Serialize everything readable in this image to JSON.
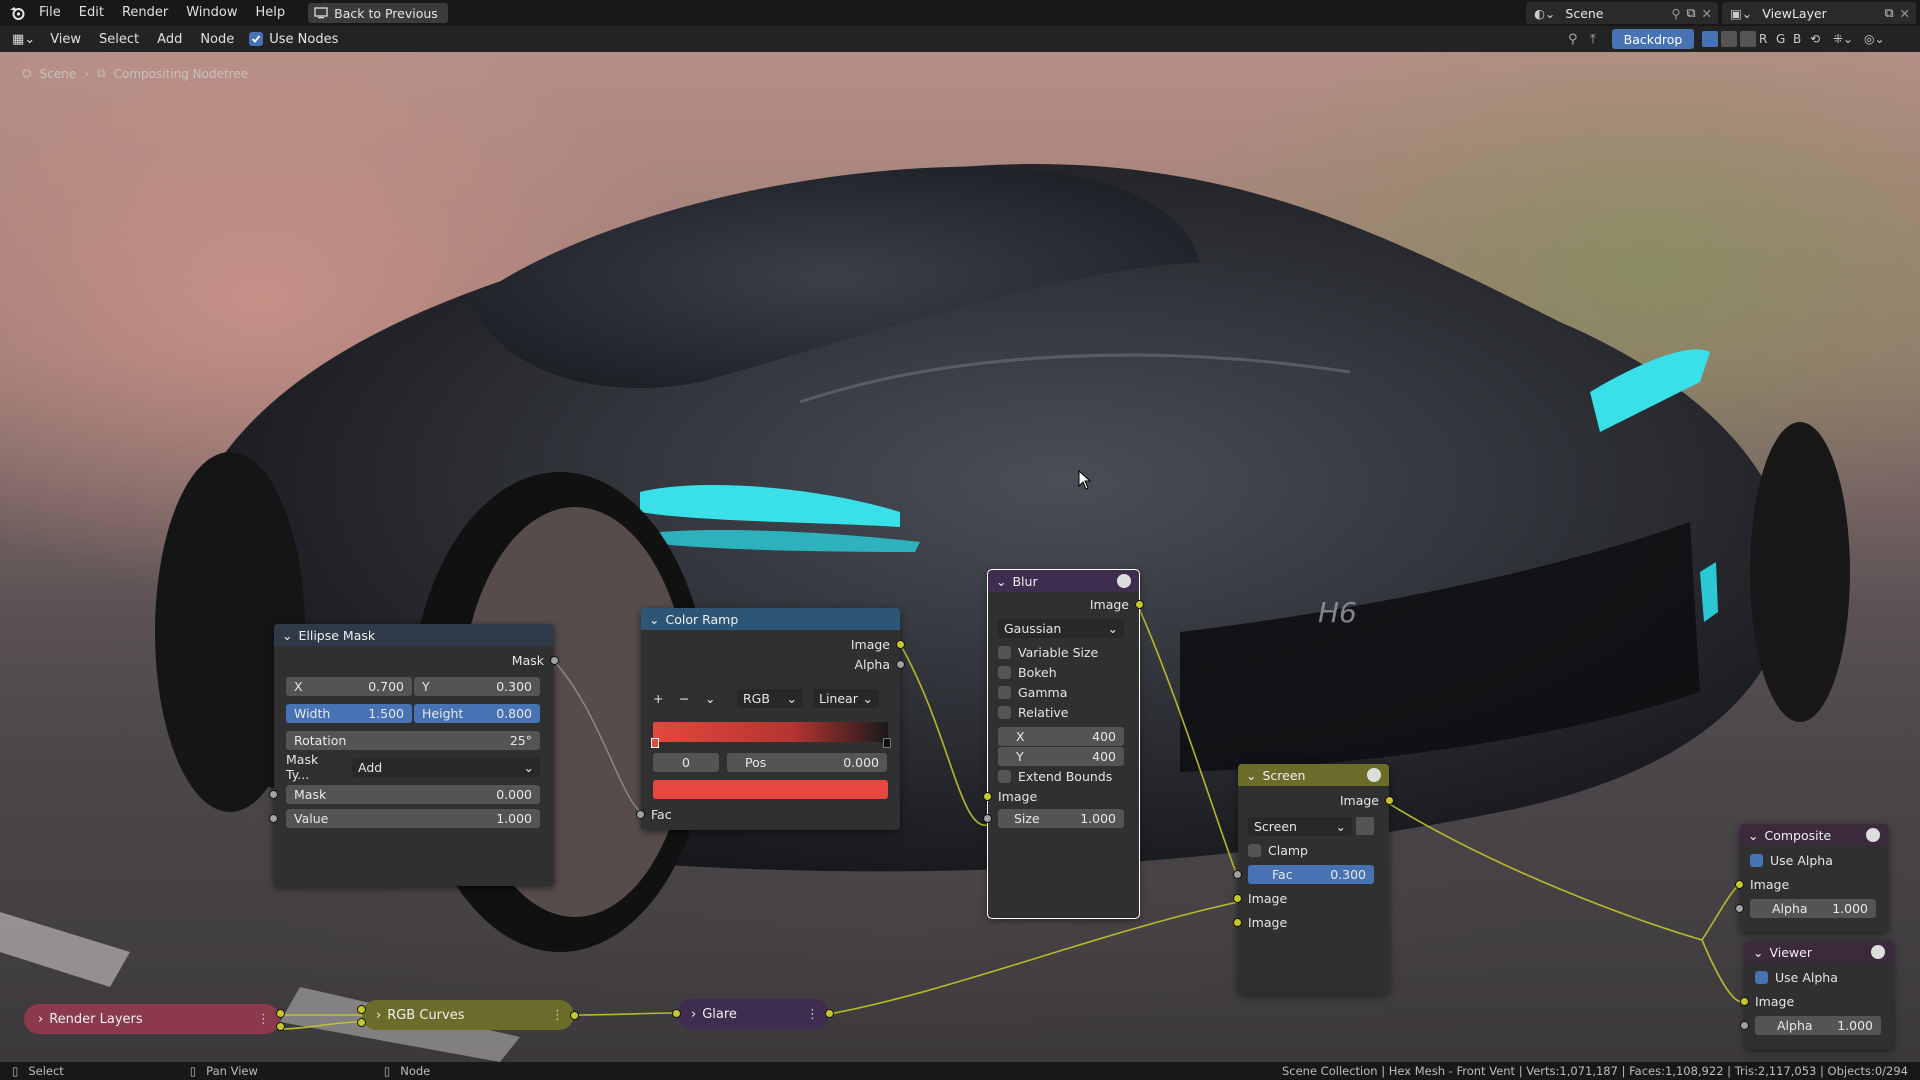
{
  "menu": {
    "items": [
      "File",
      "Edit",
      "Render",
      "Window",
      "Help"
    ],
    "back_label": "Back to Previous"
  },
  "scene": {
    "scene_name": "Scene",
    "view_layer": "ViewLayer"
  },
  "header": {
    "items": [
      "View",
      "Select",
      "Add",
      "Node"
    ],
    "use_nodes_label": "Use Nodes",
    "backdrop_label": "Backdrop"
  },
  "breadcrumb": {
    "scene": "Scene",
    "tree": "Compositing Nodetree"
  },
  "ellipse_mask": {
    "title": "Ellipse Mask",
    "out_mask": "Mask",
    "x_label": "X",
    "x_value": "0.700",
    "y_label": "Y",
    "y_value": "0.300",
    "width_label": "Width",
    "width_value": "1.500",
    "height_label": "Height",
    "height_value": "0.800",
    "rotation_label": "Rotation",
    "rotation_value": "25°",
    "mask_type_label": "Mask Ty...",
    "mask_type_value": "Add",
    "mask_label": "Mask",
    "mask_value": "0.000",
    "value_label": "Value",
    "value_value": "1.000"
  },
  "color_ramp": {
    "title": "Color Ramp",
    "out_image": "Image",
    "out_alpha": "Alpha",
    "plus": "+",
    "minus": "−",
    "mode": "RGB",
    "interp": "Linear",
    "index": "0",
    "pos_label": "Pos",
    "pos_value": "0.000",
    "fac_label": "Fac",
    "color": "#e5483e"
  },
  "blur": {
    "title": "Blur",
    "out_image": "Image",
    "filter": "Gaussian",
    "variable_size": "Variable Size",
    "bokeh": "Bokeh",
    "gamma": "Gamma",
    "relative": "Relative",
    "x_label": "X",
    "x_value": "400",
    "y_label": "Y",
    "y_value": "400",
    "extend_bounds": "Extend Bounds",
    "in_image": "Image",
    "size_label": "Size",
    "size_value": "1.000"
  },
  "screen": {
    "title": "Screen",
    "out_image": "Image",
    "blend": "Screen",
    "clamp": "Clamp",
    "fac_label": "Fac",
    "fac_value": "0.300",
    "in_image1": "Image",
    "in_image2": "Image"
  },
  "composite": {
    "title": "Composite",
    "use_alpha": "Use Alpha",
    "in_image": "Image",
    "alpha_label": "Alpha",
    "alpha_value": "1.000"
  },
  "viewer": {
    "title": "Viewer",
    "use_alpha": "Use Alpha",
    "in_image": "Image",
    "alpha_label": "Alpha",
    "alpha_value": "1.000"
  },
  "collapsed": {
    "render_layers": "Render Layers",
    "rgb_curves": "RGB Curves",
    "glare": "Glare"
  },
  "statusbar": {
    "select": "Select",
    "pan": "Pan View",
    "node": "Node",
    "stats": "Scene Collection | Hex Mesh - Front Vent | Verts:1,071,187 | Faces:1,108,922 | Tris:2,117,053 | Objects:0/294"
  },
  "colors": {
    "accent": "#4772b3",
    "socket": "#c7c729",
    "input_header": "#8a3a4c",
    "color_header": "#6b6b2a",
    "filter_header": "#3e2d4f",
    "converter_header": "#2d5575",
    "output_header": "#3a2a3c"
  }
}
